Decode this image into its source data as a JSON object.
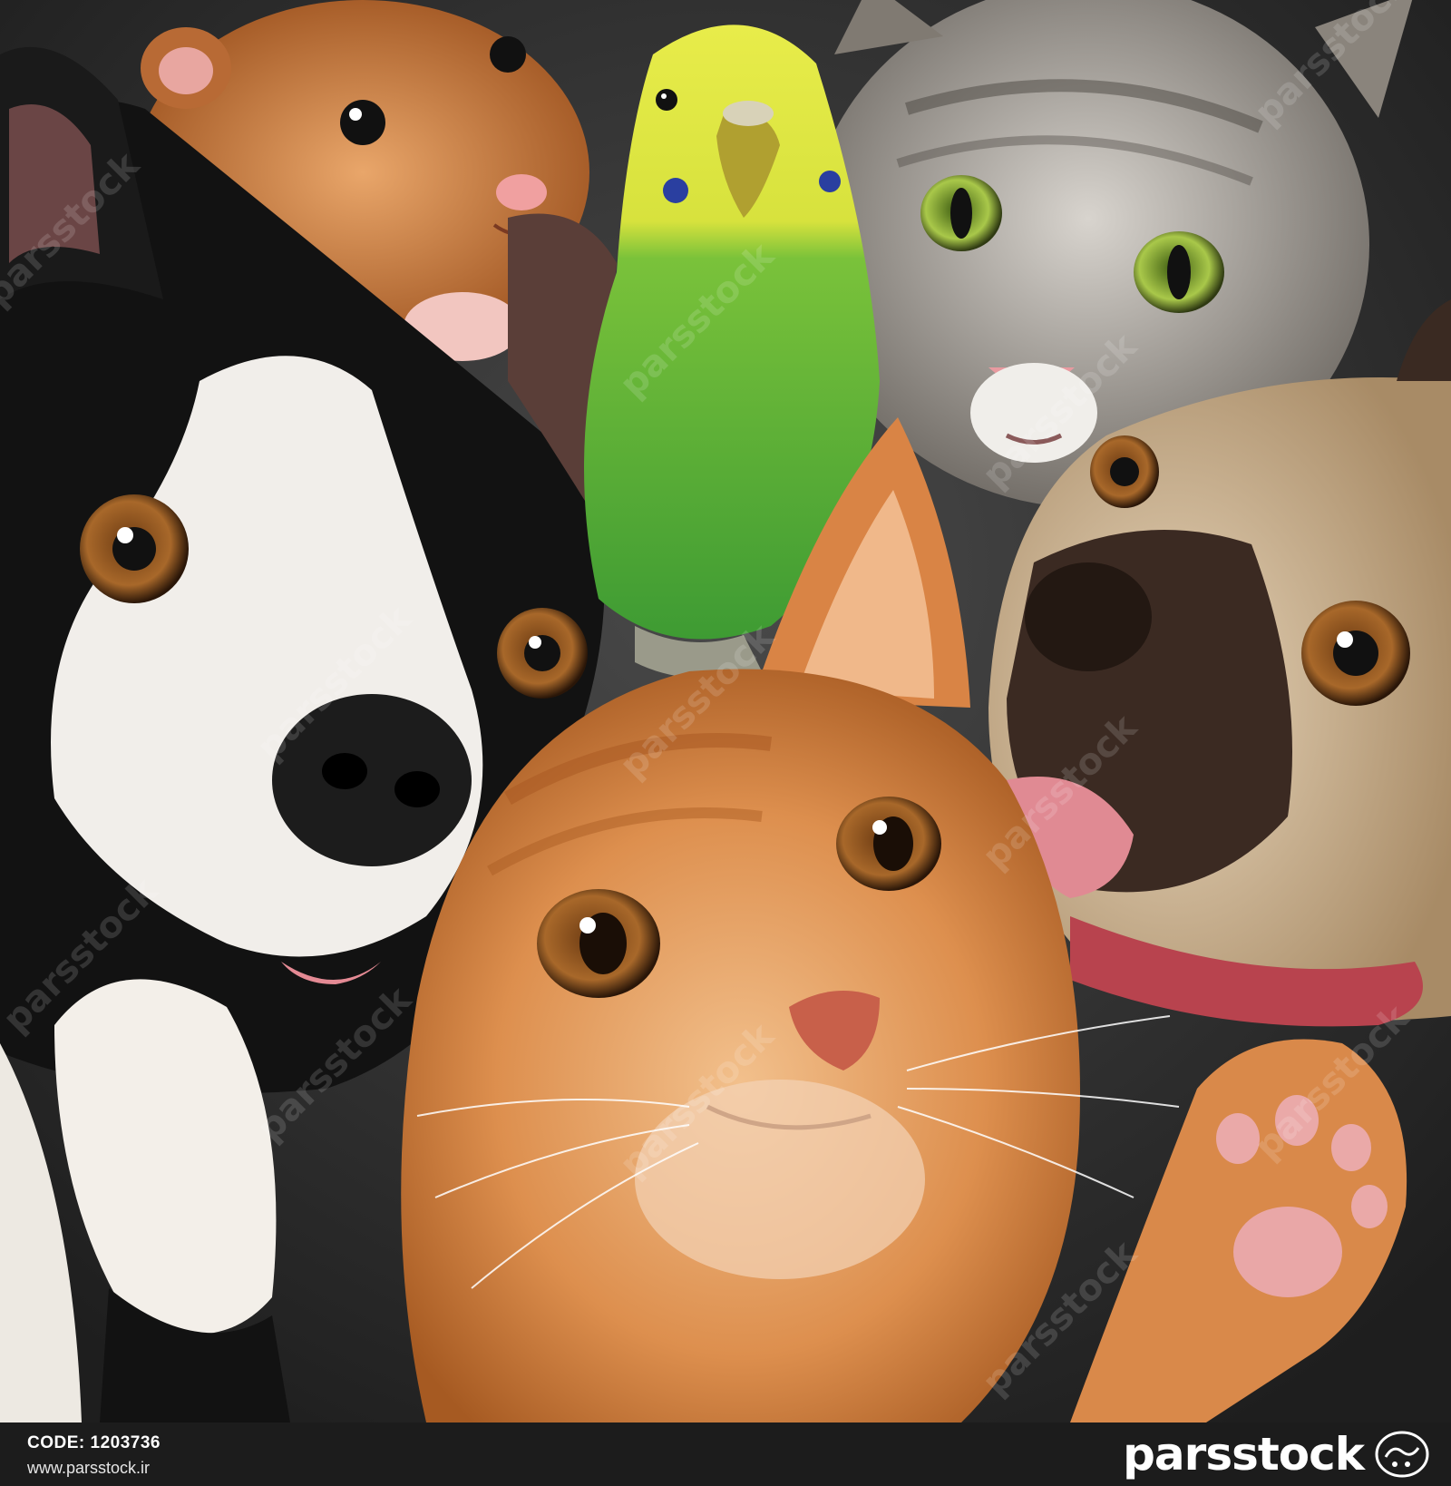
{
  "image": {
    "description_colors": {
      "background": "#2a2a2a",
      "orange_cat": "#d9894a",
      "dog_black": "#111111",
      "dog_white": "#f1eeea",
      "hamster": "#c8763a",
      "parakeet_green": "#4fae3c",
      "parakeet_yellow": "#e7e94a",
      "gray_kitten": "#9b9690",
      "pug_fawn": "#d9c3a4",
      "pug_mask": "#3b2a22",
      "tongue": "#e08a93"
    },
    "watermark_text": "parsstock"
  },
  "footer": {
    "code_label": "CODE: 1203736",
    "site": "www.parsstock.ir",
    "brand": "parsstock",
    "seal_icon": "parsstock-seal-icon"
  }
}
